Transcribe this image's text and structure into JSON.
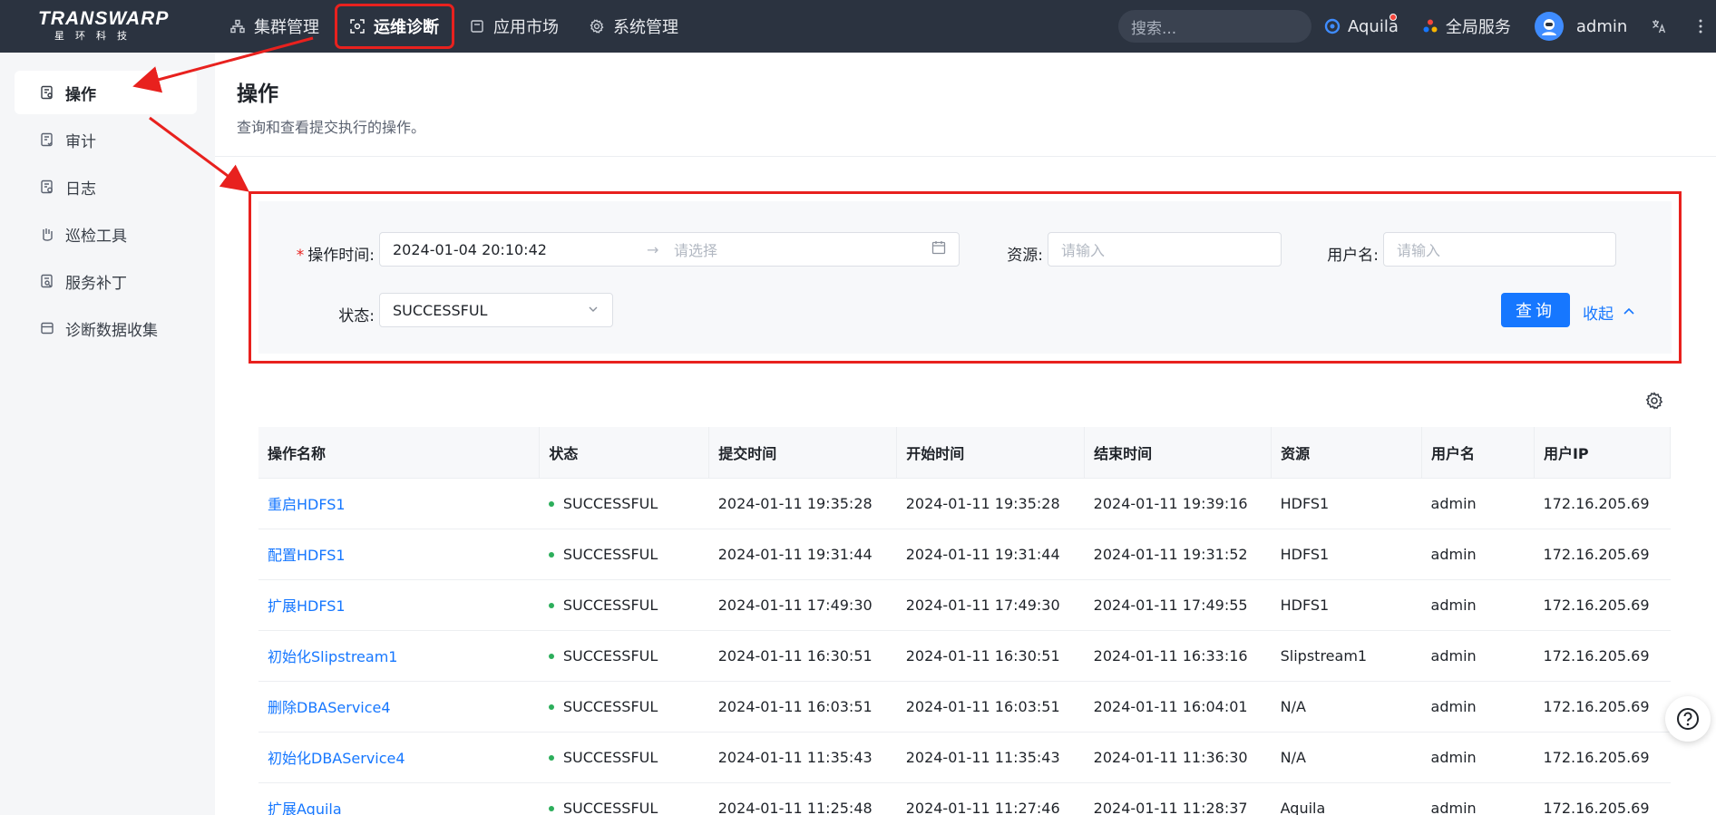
{
  "brand": {
    "name": "TRANSWARP",
    "sub": "星环科技"
  },
  "nav": [
    {
      "label": "集群管理",
      "icon": "cluster-icon"
    },
    {
      "label": "运维诊断",
      "icon": "diagnose-icon",
      "active": true
    },
    {
      "label": "应用市场",
      "icon": "market-icon"
    },
    {
      "label": "系统管理",
      "icon": "gear-icon"
    }
  ],
  "search": {
    "placeholder": "搜索..."
  },
  "top_right": {
    "aquila": "Aquila",
    "global": "全局服务",
    "user": "admin"
  },
  "sidebar": [
    {
      "label": "操作",
      "active": true
    },
    {
      "label": "审计"
    },
    {
      "label": "日志"
    },
    {
      "label": "巡检工具"
    },
    {
      "label": "服务补丁"
    },
    {
      "label": "诊断数据收集"
    }
  ],
  "page": {
    "title": "操作",
    "subtitle": "查询和查看提交执行的操作。"
  },
  "filter": {
    "time_label": "操作时间:",
    "time_start": "2024-01-04 20:10:42",
    "time_end_placeholder": "请选择",
    "resource_label": "资源:",
    "resource_placeholder": "请输入",
    "user_label": "用户名:",
    "user_placeholder": "请输入",
    "status_label": "状态:",
    "status_value": "SUCCESSFUL",
    "query_button": "查询",
    "collapse_link": "收起"
  },
  "table": {
    "headers": [
      "操作名称",
      "状态",
      "提交时间",
      "开始时间",
      "结束时间",
      "资源",
      "用户名",
      "用户IP"
    ],
    "rows": [
      [
        "重启HDFS1",
        "SUCCESSFUL",
        "2024-01-11 19:35:28",
        "2024-01-11 19:35:28",
        "2024-01-11 19:39:16",
        "HDFS1",
        "admin",
        "172.16.205.69"
      ],
      [
        "配置HDFS1",
        "SUCCESSFUL",
        "2024-01-11 19:31:44",
        "2024-01-11 19:31:44",
        "2024-01-11 19:31:52",
        "HDFS1",
        "admin",
        "172.16.205.69"
      ],
      [
        "扩展HDFS1",
        "SUCCESSFUL",
        "2024-01-11 17:49:30",
        "2024-01-11 17:49:30",
        "2024-01-11 17:49:55",
        "HDFS1",
        "admin",
        "172.16.205.69"
      ],
      [
        "初始化Slipstream1",
        "SUCCESSFUL",
        "2024-01-11 16:30:51",
        "2024-01-11 16:30:51",
        "2024-01-11 16:33:16",
        "Slipstream1",
        "admin",
        "172.16.205.69"
      ],
      [
        "删除DBAService4",
        "SUCCESSFUL",
        "2024-01-11 16:03:51",
        "2024-01-11 16:03:51",
        "2024-01-11 16:04:01",
        "N/A",
        "admin",
        "172.16.205.69"
      ],
      [
        "初始化DBAService4",
        "SUCCESSFUL",
        "2024-01-11 11:35:43",
        "2024-01-11 11:35:43",
        "2024-01-11 11:36:30",
        "N/A",
        "admin",
        "172.16.205.69"
      ],
      [
        "扩展Aquila",
        "SUCCESSFUL",
        "2024-01-11 11:25:48",
        "2024-01-11 11:27:46",
        "2024-01-11 11:28:37",
        "Aquila",
        "admin",
        "172.16.205.69"
      ]
    ]
  },
  "colors": {
    "topbar": "#2b3340",
    "accent": "#1677ff",
    "highlight": "#e8211e",
    "success": "#2cae5b"
  }
}
